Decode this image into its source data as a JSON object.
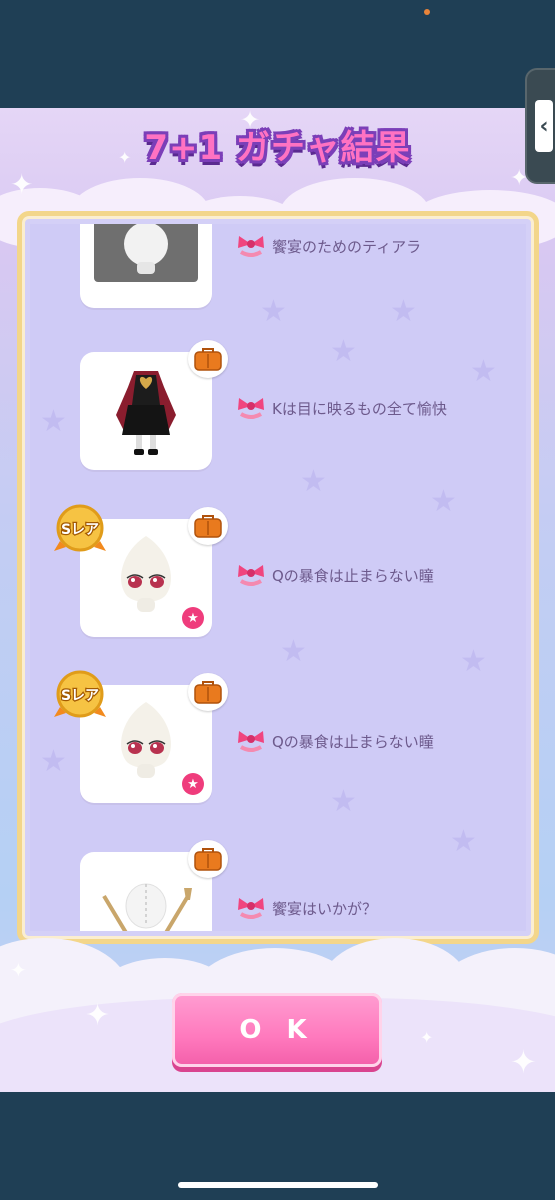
{
  "dialog": {
    "title": "7+1 ガチャ結果",
    "ok_label": "O K"
  },
  "colors": {
    "title_pink": "#ff72c2",
    "title_outline": "#7b3fb8",
    "frame_gold": "#f3d68a",
    "ok_pink": "#ff79bd",
    "screen_bg": "#1f3f55"
  },
  "items": [
    {
      "name": "饗宴のためのティアラ",
      "type": "tiara",
      "badges": []
    },
    {
      "name": "Kは目に映るもの全て愉快",
      "type": "dress",
      "badges": [
        "bag-icon"
      ]
    },
    {
      "name": "Qの暴食は止まらない瞳",
      "type": "eyes",
      "badges": [
        "bag-icon",
        "s-rare-badge",
        "pink-star-icon"
      ],
      "rarity": "Sレア"
    },
    {
      "name": "Qの暴食は止まらない瞳",
      "type": "eyes",
      "badges": [
        "bag-icon",
        "s-rare-badge",
        "pink-star-icon"
      ],
      "rarity": "Sレア"
    },
    {
      "name": "饗宴はいかが？",
      "type": "cutlery",
      "badges": [
        "bag-icon"
      ]
    }
  ],
  "side_handle": {
    "icon": "chevron-left-icon"
  }
}
